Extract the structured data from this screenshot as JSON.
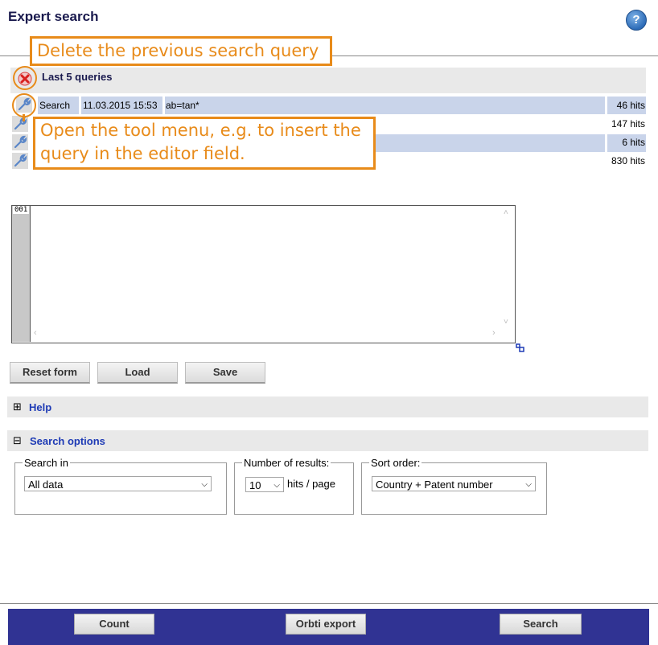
{
  "header": {
    "title": "Expert search",
    "help_icon": "help-circle-icon",
    "help_glyph": "?"
  },
  "annotations": {
    "delete_callout": "Delete the previous search query",
    "tool_callout_line1": "Open the tool menu, e.g. to insert the",
    "tool_callout_line2": "query in the editor field.",
    "accent_color": "#e88b1a"
  },
  "queries": {
    "title": "Last 5 queries",
    "delete_icon": "red-x-icon",
    "rows": [
      {
        "type": "Search",
        "date": "11.03.2015 15:53",
        "query": "ab=tan*",
        "hits": "46 hits",
        "highlight": true
      },
      {
        "type": "",
        "date": "",
        "query": "",
        "hits": "147 hits",
        "highlight": false
      },
      {
        "type": "",
        "date": "",
        "query": "",
        "hits": "6 hits",
        "highlight": true
      },
      {
        "type": "",
        "date": "",
        "query": "",
        "hits": "830 hits",
        "highlight": false
      }
    ]
  },
  "editor": {
    "line_number": "001",
    "value": ""
  },
  "form_buttons": {
    "reset": "Reset form",
    "load": "Load",
    "save": "Save"
  },
  "help_section": {
    "toggle": "⊞",
    "label": "Help"
  },
  "search_options": {
    "toggle": "⊟",
    "label": "Search options",
    "search_in": {
      "legend": "Search in",
      "value": "All data"
    },
    "results": {
      "legend": "Number of results:",
      "value": "10",
      "suffix": "hits / page"
    },
    "sort": {
      "legend": "Sort order:",
      "value": "Country + Patent number"
    }
  },
  "footer": {
    "count": "Count",
    "export": "Orbti export",
    "search": "Search",
    "background": "#303393"
  }
}
